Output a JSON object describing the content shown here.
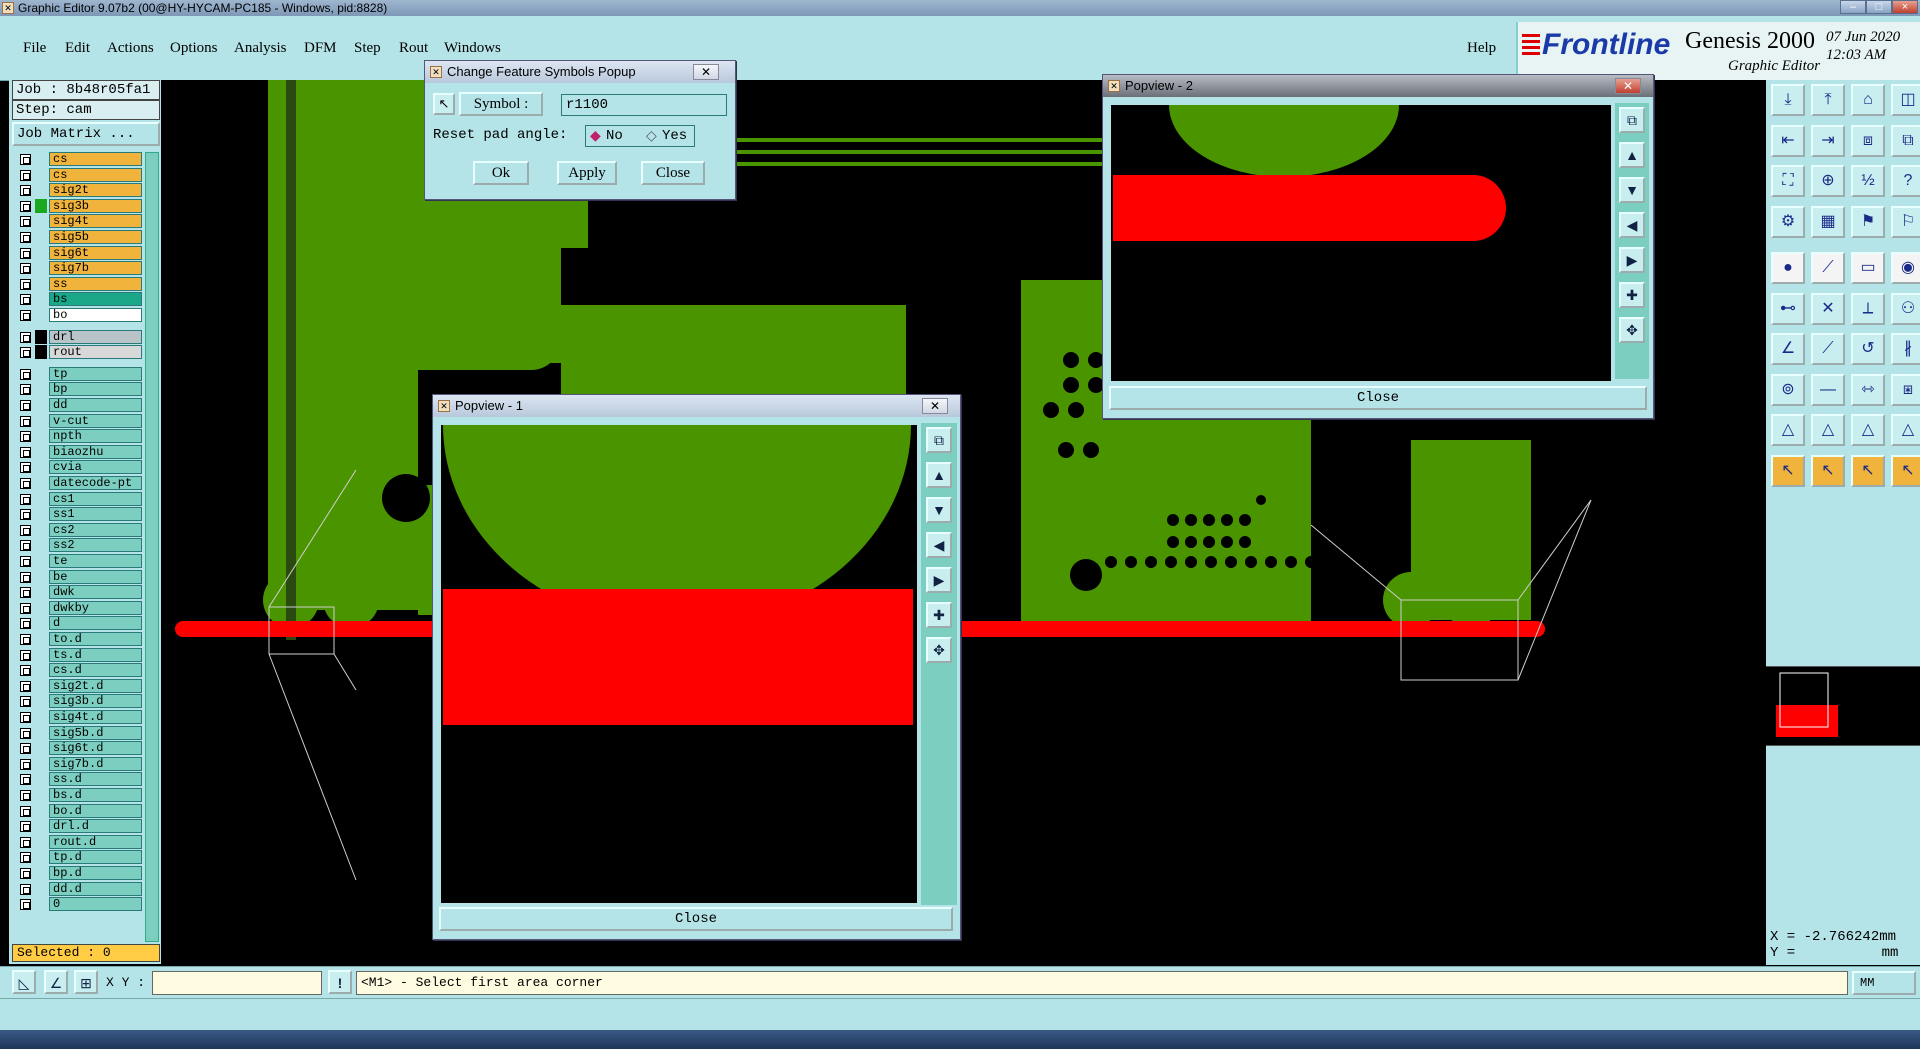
{
  "window": {
    "title": "Graphic Editor 9.07b2 (00@HY-HYCAM-PC185 - Windows, pid:8828)",
    "minimize": "–",
    "maximize": "□",
    "close": "×"
  },
  "menu": {
    "items": [
      "File",
      "Edit",
      "Actions",
      "Options",
      "Analysis",
      "DFM",
      "Step",
      "Rout",
      "Windows"
    ],
    "help": "Help"
  },
  "brand": {
    "frontline": "Frontline",
    "product": "Genesis 2000",
    "subtitle": "Graphic Editor",
    "date": "07 Jun 2020",
    "time": "12:03 AM"
  },
  "job": {
    "job_label": "Job : 8b48r05fa1",
    "step_label": "Step: cam",
    "matrix_button": "Job Matrix ..."
  },
  "layers": {
    "group1": [
      {
        "name": "cs",
        "color": "#f0b43c"
      },
      {
        "name": "cs",
        "color": "#f0b43c"
      },
      {
        "name": "sig2t",
        "color": "#f0b43c"
      },
      {
        "name": "sig3b",
        "color": "#f0b43c"
      },
      {
        "name": "sig4t",
        "color": "#f0b43c"
      },
      {
        "name": "sig5b",
        "color": "#f0b43c"
      },
      {
        "name": "sig6t",
        "color": "#f0b43c"
      },
      {
        "name": "sig7b",
        "color": "#f0b43c"
      },
      {
        "name": "ss",
        "color": "#f0b43c"
      },
      {
        "name": "bs",
        "color": "#1aa888"
      },
      {
        "name": "bo",
        "color": "#ffffff"
      }
    ],
    "group2": [
      {
        "name": "drl",
        "color": "#b8c4c8"
      },
      {
        "name": "rout",
        "color": "#d8d8d8"
      }
    ],
    "group3": [
      "tp",
      "bp",
      "dd",
      "v-cut",
      "npth",
      "biaozhu",
      "cvia",
      "datecode-pt",
      "cs1",
      "ss1",
      "cs2",
      "ss2",
      "te",
      "be",
      "dwk",
      "dwkby",
      "d",
      "to.d",
      "ts.d",
      "cs.d",
      "sig2t.d",
      "sig3b.d",
      "sig4t.d",
      "sig5b.d",
      "sig6t.d",
      "sig7b.d",
      "ss.d",
      "bs.d",
      "bo.d",
      "drl.d",
      "rout.d",
      "tp.d",
      "bp.d",
      "dd.d",
      "0"
    ],
    "selected": "Selected : 0"
  },
  "change_symbol_popup": {
    "title": "Change Feature Symbols Popup",
    "symbol_label": "Symbol :",
    "symbol_value": "r1100",
    "reset_label": "Reset pad angle:",
    "opt_no": "No",
    "opt_yes": "Yes",
    "ok": "Ok",
    "apply": "Apply",
    "close": "Close"
  },
  "popview1": {
    "title": "Popview - 1",
    "close": "Close"
  },
  "popview2": {
    "title": "Popview - 2",
    "close": "Close"
  },
  "coords": {
    "x": "X = -2.766242mm",
    "y": "Y = ",
    "y_unit": "mm"
  },
  "command": {
    "xy_label": "X Y :",
    "xy_value": "",
    "prompt": "<M1> - Select first area corner",
    "units": "MM"
  },
  "colors": {
    "board_green": "#4a9400",
    "trace_red": "#ff0000",
    "panel_bg": "#b4e4e8",
    "layer_orange": "#f0b43c"
  }
}
